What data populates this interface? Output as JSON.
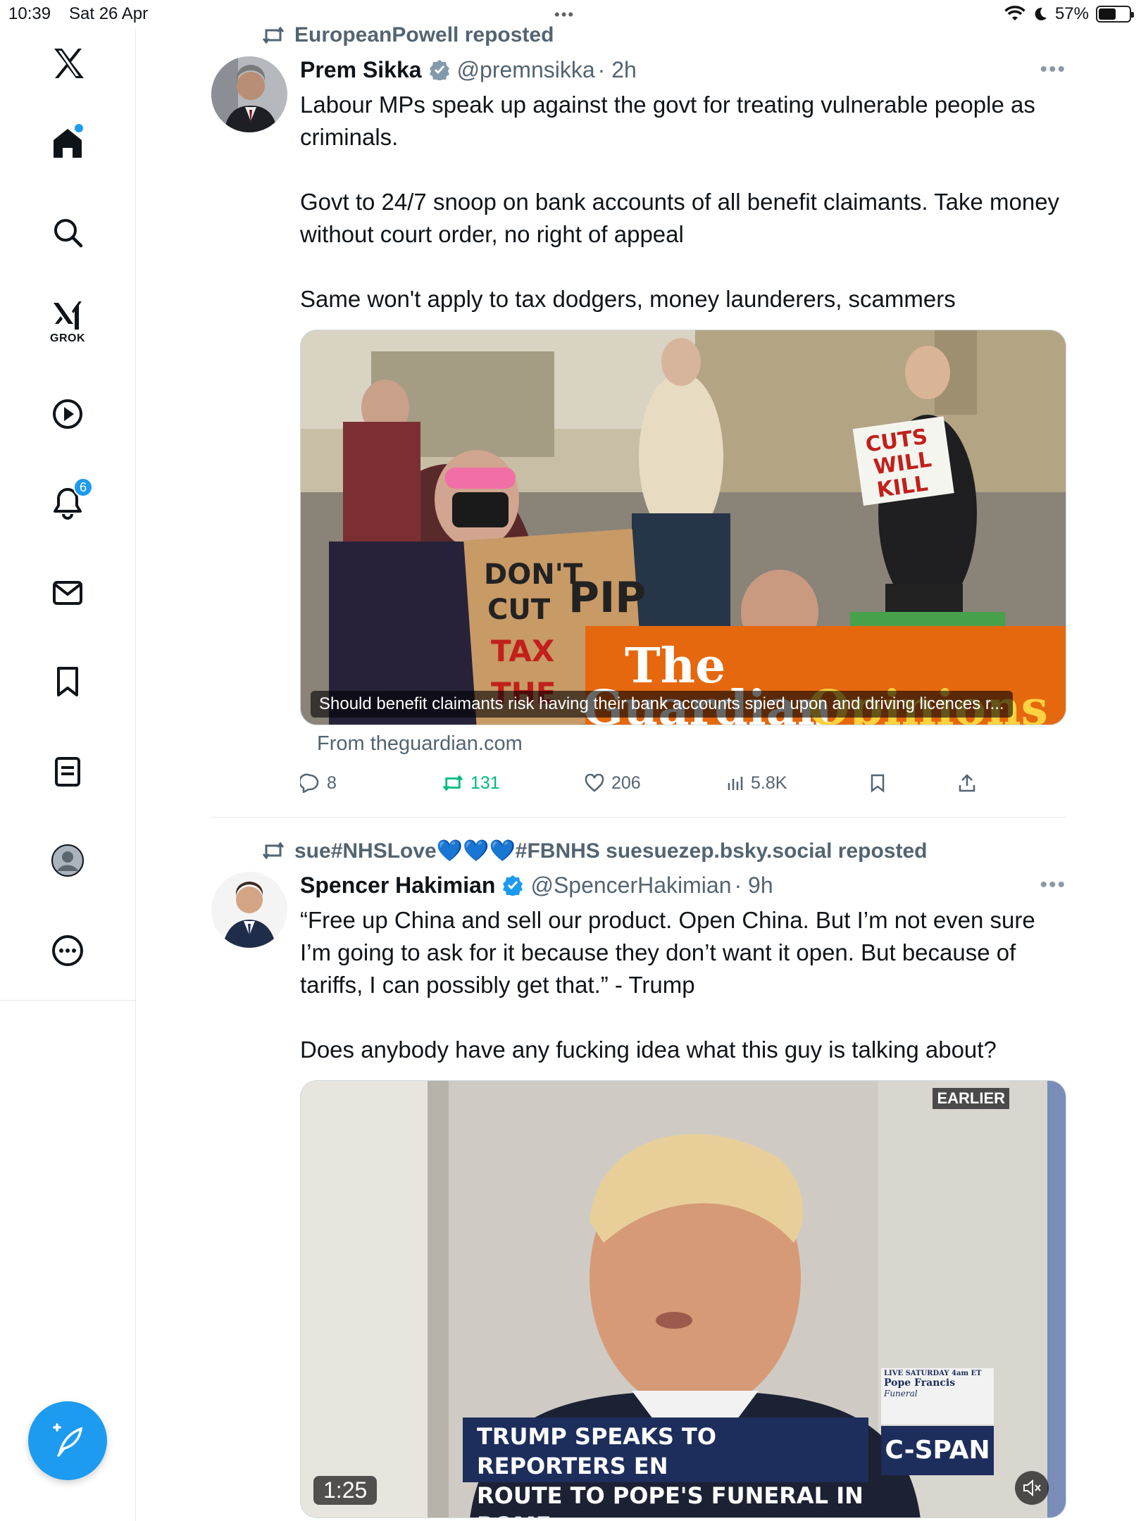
{
  "status_bar": {
    "time": "10:39",
    "date": "Sat 26 Apr",
    "battery": "57%",
    "battery_level": 0.57
  },
  "sidebar": {
    "items": [
      {
        "name": "home",
        "icon": "home-icon"
      },
      {
        "name": "explore",
        "icon": "search-icon"
      },
      {
        "name": "grok",
        "icon": "grok-icon",
        "label": "GROK"
      },
      {
        "name": "videos",
        "icon": "play-icon"
      },
      {
        "name": "notifications",
        "icon": "bell-icon",
        "badge": "6"
      },
      {
        "name": "messages",
        "icon": "mail-icon"
      },
      {
        "name": "bookmarks",
        "icon": "bookmark-icon"
      },
      {
        "name": "lists",
        "icon": "list-icon"
      },
      {
        "name": "profile",
        "icon": "profile-icon"
      },
      {
        "name": "more",
        "icon": "more-icon"
      }
    ],
    "compose_icon": "compose-icon"
  },
  "accent_color": "#1d9bf0",
  "tweets": [
    {
      "repost_by": "EuropeanPowell reposted",
      "name": "Prem Sikka",
      "handle": "@premnsikka",
      "time": "· 2h",
      "text": [
        "Labour MPs speak up against the govt for treating vulnerable people as criminals.",
        "",
        "Govt to 24/7 snoop on bank accounts of all benefit claimants. Take money without court order, no right of appeal",
        "",
        "Same won't apply to tax dodgers, money launderers, scammers"
      ],
      "media": {
        "caption": "Should benefit claimants risk having their bank accounts spied upon and driving licences r...",
        "brand_a": "The",
        "brand_b": "Guardian",
        "brand_c": "Opinions",
        "sign_left": [
          "DON'T",
          "CUT",
          "PIP",
          "TAX",
          "THE"
        ],
        "sign_right": [
          "CUTS",
          "WILL",
          "KILL"
        ]
      },
      "from": "From theguardian.com",
      "actions": {
        "replies": "8",
        "reposts": "131",
        "likes": "206",
        "views": "5.8K"
      }
    },
    {
      "repost_by": "sue#NHSLove💙💙💙#FBNHS suesuezep.bsky.social reposted",
      "name": "Spencer Hakimian",
      "handle": "@SpencerHakimian",
      "time": "· 9h",
      "text": [
        "“Free up China and sell our product. Open China. But I’m not even sure I’m going to ask for it because they don’t want it open. But because of tariffs, I can possibly get that.” - Trump",
        "",
        "Does anybody have any fucking idea what this guy is talking about?"
      ],
      "media": {
        "tag": "EARLIER",
        "banner_line1": "TRUMP SPEAKS TO REPORTERS EN",
        "banner_line2": "ROUTE TO POPE'S FUNERAL IN ROME",
        "promo_top": "LIVE SATURDAY 4am ET",
        "promo_title": "Pope Francis",
        "promo_sub": "Funeral",
        "network": "C-SPAN",
        "duration": "1:25"
      }
    }
  ]
}
